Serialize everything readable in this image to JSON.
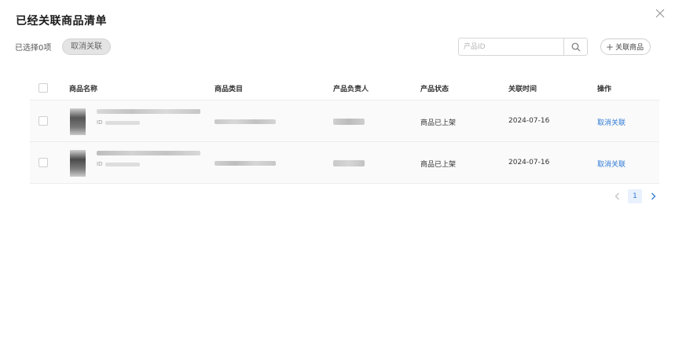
{
  "modal": {
    "title": "已经关联商品清单",
    "selected_text": "已选择0项",
    "unlink_button": "取消关联",
    "search_placeholder": "产品ID",
    "add_button": "关联商品"
  },
  "table": {
    "headers": [
      "商品名称",
      "商品类目",
      "产品负责人",
      "产品状态",
      "关联时间",
      "操作"
    ],
    "rows": [
      {
        "id_label": "ID",
        "status": "商品已上架",
        "date": "2024-07-16",
        "action": "取消关联"
      },
      {
        "id_label": "ID",
        "status": "商品已上架",
        "date": "2024-07-16",
        "action": "取消关联"
      }
    ]
  },
  "pagination": {
    "current_page": "1"
  },
  "colors": {
    "link": "#2f7ad6",
    "row_bg": "#fafafa",
    "button_bg": "#e4e4e4"
  },
  "icons": {
    "close": "close-icon",
    "search": "search-icon",
    "prev": "chevron-left-icon",
    "next": "chevron-right-icon"
  }
}
